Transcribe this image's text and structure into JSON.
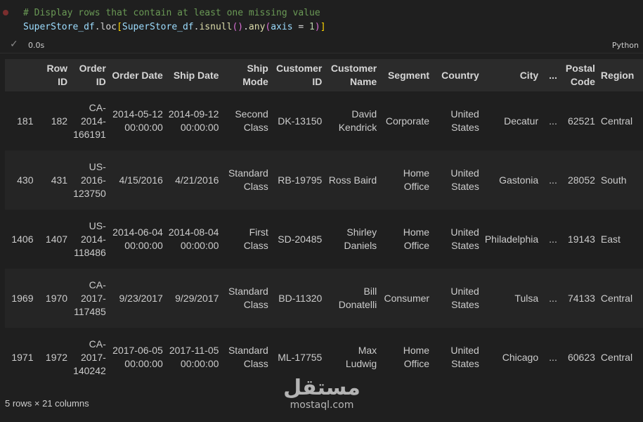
{
  "code": {
    "comment": "# Display rows that contain at least one missing value",
    "line2": {
      "var1": "SuperStore_df",
      "dot_loc": ".loc",
      "open1": "[",
      "var2": "SuperStore_df",
      "dot1": ".",
      "func1": "isnull",
      "paren1": "()",
      "dot2": ".",
      "func2": "any",
      "open2": "(",
      "arg": "axis",
      "eq": " = ",
      "num": "1",
      "close2": ")",
      "close1": "]"
    }
  },
  "status": {
    "check_icon": "check-icon",
    "exec_time": "0.0s",
    "language": "Python"
  },
  "table": {
    "columns": [
      "",
      "Row ID",
      "Order ID",
      "Order Date",
      "Ship Date",
      "Ship Mode",
      "Customer ID",
      "Customer Name",
      "Segment",
      "Country",
      "City",
      "...",
      "Postal Code",
      "Region"
    ],
    "rows": [
      [
        "181",
        "182",
        "CA-2014-166191",
        "2014-05-12 00:00:00",
        "2014-09-12 00:00:00",
        "Second Class",
        "DK-13150",
        "David Kendrick",
        "Corporate",
        "United States",
        "Decatur",
        "...",
        "62521",
        "Central"
      ],
      [
        "430",
        "431",
        "US-2016-123750",
        "4/15/2016",
        "4/21/2016",
        "Standard Class",
        "RB-19795",
        "Ross Baird",
        "Home Office",
        "United States",
        "Gastonia",
        "...",
        "28052",
        "South"
      ],
      [
        "1406",
        "1407",
        "US-2014-118486",
        "2014-06-04 00:00:00",
        "2014-08-04 00:00:00",
        "First Class",
        "SD-20485",
        "Shirley Daniels",
        "Home Office",
        "United States",
        "Philadelphia",
        "...",
        "19143",
        "East"
      ],
      [
        "1969",
        "1970",
        "CA-2017-117485",
        "9/23/2017",
        "9/29/2017",
        "Standard Class",
        "BD-11320",
        "Bill Donatelli",
        "Consumer",
        "United States",
        "Tulsa",
        "...",
        "74133",
        "Central"
      ],
      [
        "1971",
        "1972",
        "CA-2017-140242",
        "2017-06-05 00:00:00",
        "2017-11-05 00:00:00",
        "Standard Class",
        "ML-17755",
        "Max Ludwig",
        "Home Office",
        "United States",
        "Chicago",
        "...",
        "60623",
        "Central"
      ]
    ]
  },
  "footer": "5 rows × 21 columns",
  "watermark": {
    "word": "مستقل",
    "sub": "mostaql.com"
  }
}
